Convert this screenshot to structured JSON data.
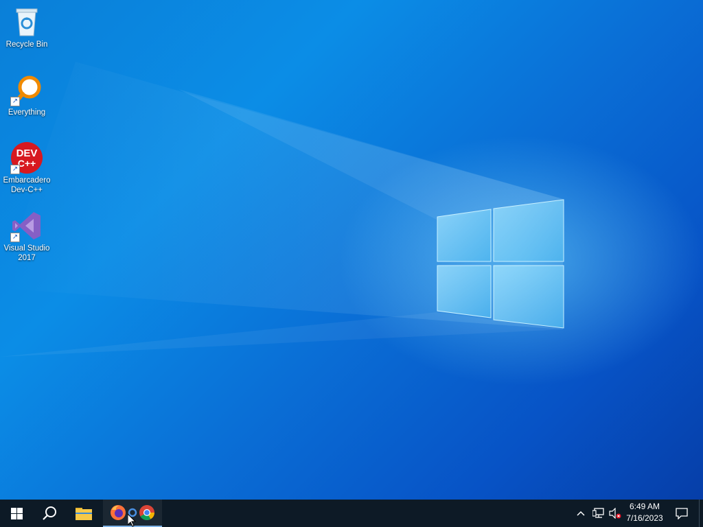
{
  "desktop": {
    "icons": [
      {
        "label": "Recycle Bin",
        "icon": "recycle-bin-icon"
      },
      {
        "label": "Everything",
        "icon": "everything-search-icon"
      },
      {
        "label": "Embarcadero Dev-C++",
        "icon": "dev-cpp-icon",
        "badge": "DEV\nC++"
      },
      {
        "label": "Visual Studio 2017",
        "icon": "visual-studio-icon"
      }
    ]
  },
  "taskbar": {
    "start": "start-icon",
    "search": "search-icon",
    "pinned": [
      "file-explorer-icon",
      "firefox-icon",
      "chrome-icon"
    ],
    "tray": {
      "chevron": "show-hidden-icons-chevron",
      "network": "network-icon",
      "volume": "volume-muted-icon",
      "time": "6:49 AM",
      "date": "7/16/2023",
      "notifications": "action-center-icon"
    }
  },
  "colors": {
    "taskbar": "#0d1a26",
    "wallpaper_blue": "#0a7fd8"
  }
}
